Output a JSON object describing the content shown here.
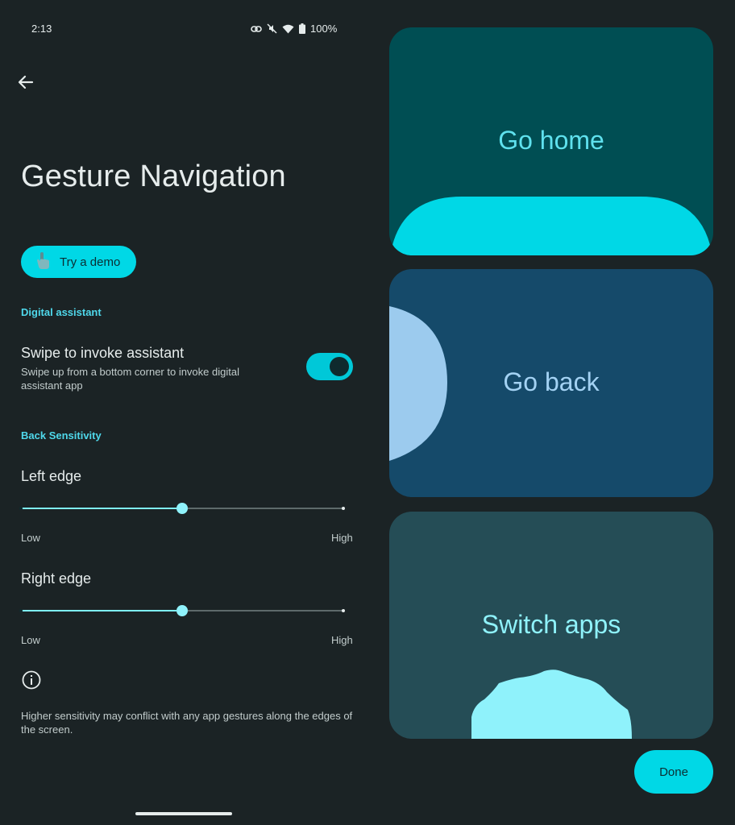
{
  "status_bar": {
    "time": "2:13",
    "battery": "100%"
  },
  "page": {
    "title": "Gesture Navigation",
    "demo_label": "Try a demo"
  },
  "assistant": {
    "section": "Digital assistant",
    "title": "Swipe to invoke assistant",
    "subtitle": "Swipe up from a bottom corner to invoke digital assistant app",
    "enabled": true
  },
  "sensitivity": {
    "section": "Back Sensitivity",
    "left": {
      "label": "Left edge",
      "low": "Low",
      "high": "High",
      "value": 0.5
    },
    "right": {
      "label": "Right edge",
      "low": "Low",
      "high": "High",
      "value": 0.5
    }
  },
  "footnote": "Higher sensitivity may conflict with any app gestures along the edges of the screen.",
  "cards": {
    "home": "Go home",
    "back": "Go back",
    "switch": "Switch apps"
  },
  "done_label": "Done",
  "colors": {
    "accent": "#00d8e6",
    "background": "#1b2325",
    "section": "#4fd8eb"
  }
}
